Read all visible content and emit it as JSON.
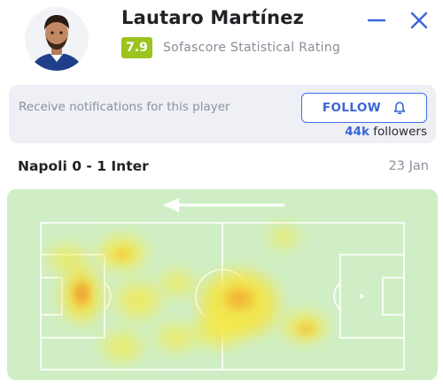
{
  "player": {
    "name": "Lautaro Martínez",
    "rating": "7.9",
    "rating_label": "Sofascore Statistical Rating",
    "rating_color": "#9bc41f",
    "avatar_icon": "player-portrait"
  },
  "window": {
    "minimize_icon": "minus-icon",
    "close_icon": "close-icon"
  },
  "notifications": {
    "text": "Receive notifications for this player",
    "follow_label": "FOLLOW",
    "bell_icon": "bell-icon",
    "followers_count": "44k",
    "followers_label": "followers"
  },
  "match": {
    "title": "Napoli 0 - 1 Inter",
    "date": "23 Jan"
  },
  "heatmap": {
    "direction_icon": "arrow-left-icon",
    "pitch_color": "#cfeec5",
    "accent_color": "#3a66d6"
  }
}
